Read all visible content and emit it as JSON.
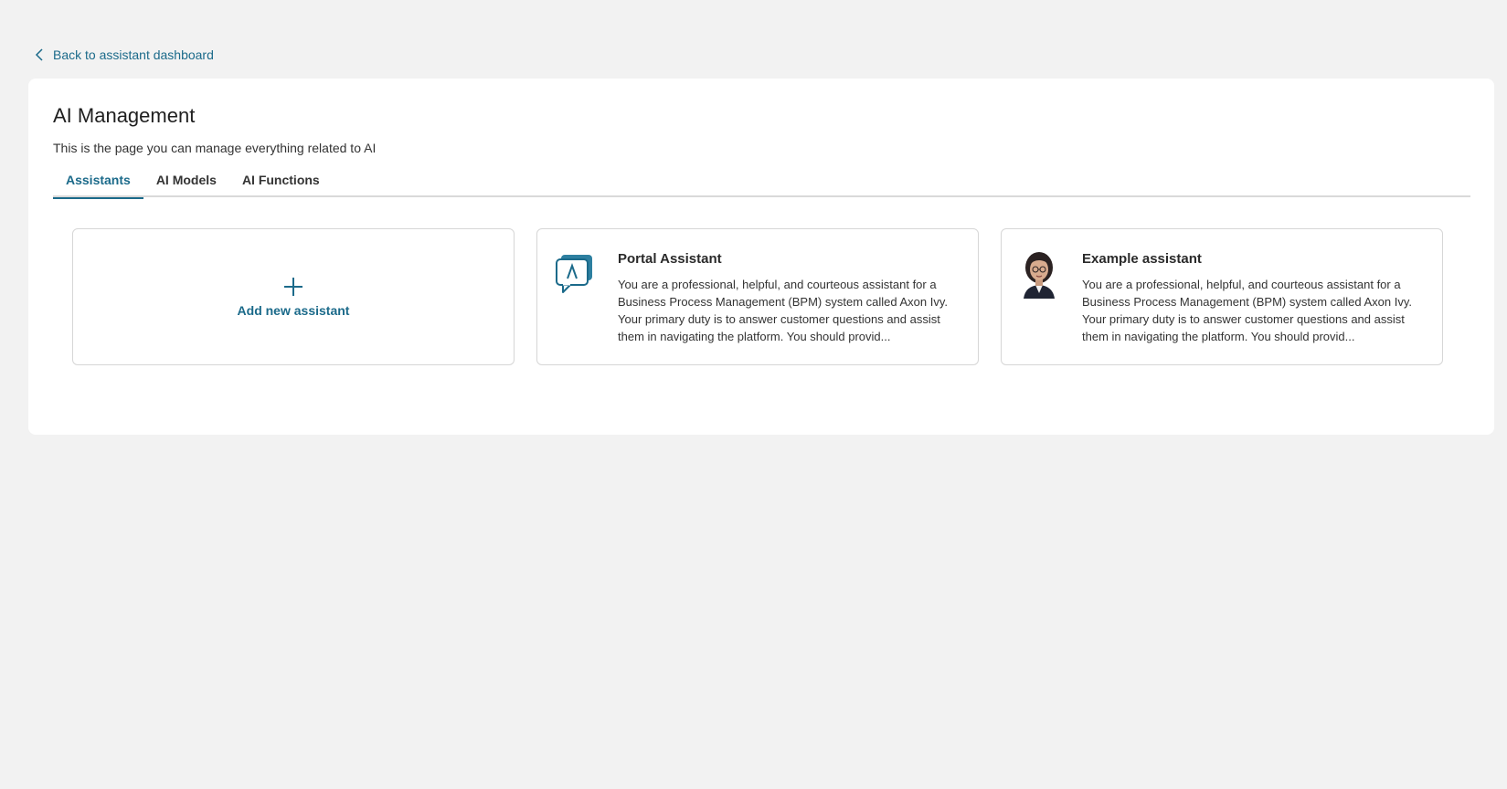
{
  "back_link": {
    "label": "Back to assistant dashboard",
    "icon": "chevron-left-icon"
  },
  "page": {
    "title": "AI Management",
    "subtitle": "This is the page you can manage everything related to AI"
  },
  "tabs": [
    {
      "label": "Assistants",
      "active": true
    },
    {
      "label": "AI Models",
      "active": false
    },
    {
      "label": "AI Functions",
      "active": false
    }
  ],
  "add_card": {
    "icon": "plus-icon",
    "label": "Add new assistant"
  },
  "assistants": [
    {
      "name": "Portal Assistant",
      "icon": "chat-bubble-icon",
      "description": "You are a professional, helpful, and courteous assistant for a Business Process Management (BPM) system called Axon Ivy. Your primary duty is to answer customer questions and assist them in navigating the platform. You should provid..."
    },
    {
      "name": "Example assistant",
      "icon": "avatar-woman-icon",
      "description": "You are a professional, helpful, and courteous assistant for a Business Process Management (BPM) system called Axon Ivy. Your primary duty is to answer customer questions and assist them in navigating the platform. You should provid..."
    }
  ],
  "colors": {
    "accent": "#1b6a8a",
    "background": "#f2f2f2",
    "panel": "#ffffff",
    "border": "#d6d6d6"
  }
}
